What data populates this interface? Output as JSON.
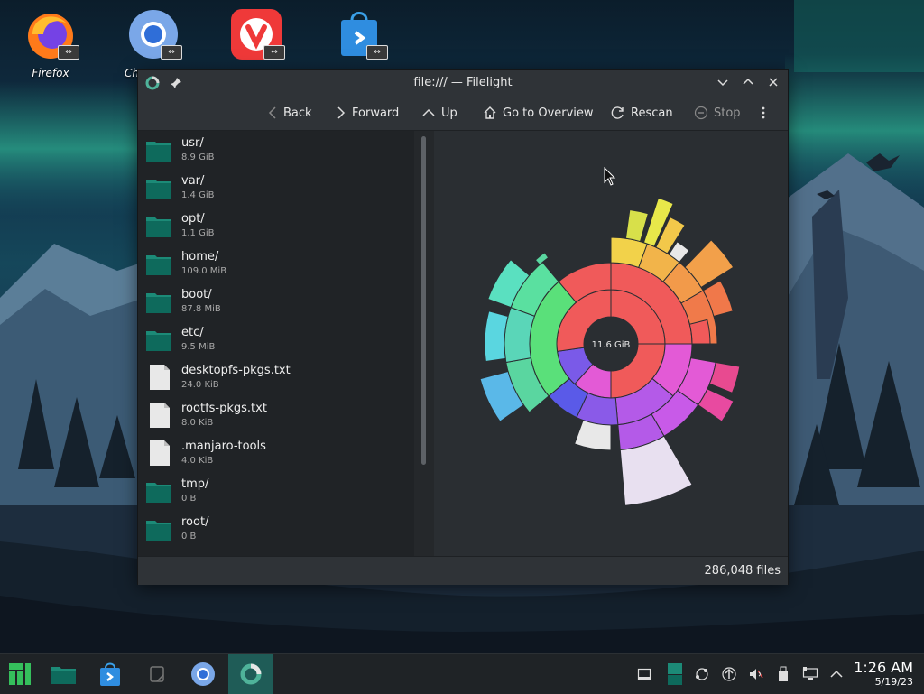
{
  "desktop": {
    "icons": [
      {
        "label": "Firefox"
      },
      {
        "label": "Ch"
      },
      {
        "label": ""
      },
      {
        "label": ""
      }
    ]
  },
  "window": {
    "title": "file:/// — Filelight",
    "toolbar": {
      "back": "Back",
      "forward": "Forward",
      "up": "Up",
      "overview": "Go to Overview",
      "rescan": "Rescan",
      "stop": "Stop"
    },
    "files": [
      {
        "name": "usr/",
        "size": "8.9 GiB",
        "type": "folder"
      },
      {
        "name": "var/",
        "size": "1.4 GiB",
        "type": "folder"
      },
      {
        "name": "opt/",
        "size": "1.1 GiB",
        "type": "folder"
      },
      {
        "name": "home/",
        "size": "109.0 MiB",
        "type": "folder"
      },
      {
        "name": "boot/",
        "size": "87.8 MiB",
        "type": "folder"
      },
      {
        "name": "etc/",
        "size": "9.5 MiB",
        "type": "folder"
      },
      {
        "name": "desktopfs-pkgs.txt",
        "size": "24.0 KiB",
        "type": "file"
      },
      {
        "name": "rootfs-pkgs.txt",
        "size": "8.0 KiB",
        "type": "file"
      },
      {
        "name": ".manjaro-tools",
        "size": "4.0 KiB",
        "type": "file"
      },
      {
        "name": "tmp/",
        "size": "0 B",
        "type": "folder"
      },
      {
        "name": "root/",
        "size": "0 B",
        "type": "folder"
      }
    ],
    "center_label": "11.6 GiB",
    "status": "286,048 files"
  },
  "taskbar": {
    "time": "1:26 AM",
    "date": "5/19/23"
  },
  "colors": {
    "accent": "#1f5c57",
    "folder": "#0e6a5c",
    "window_bg": "#2a2e32",
    "list_bg": "#202326"
  }
}
